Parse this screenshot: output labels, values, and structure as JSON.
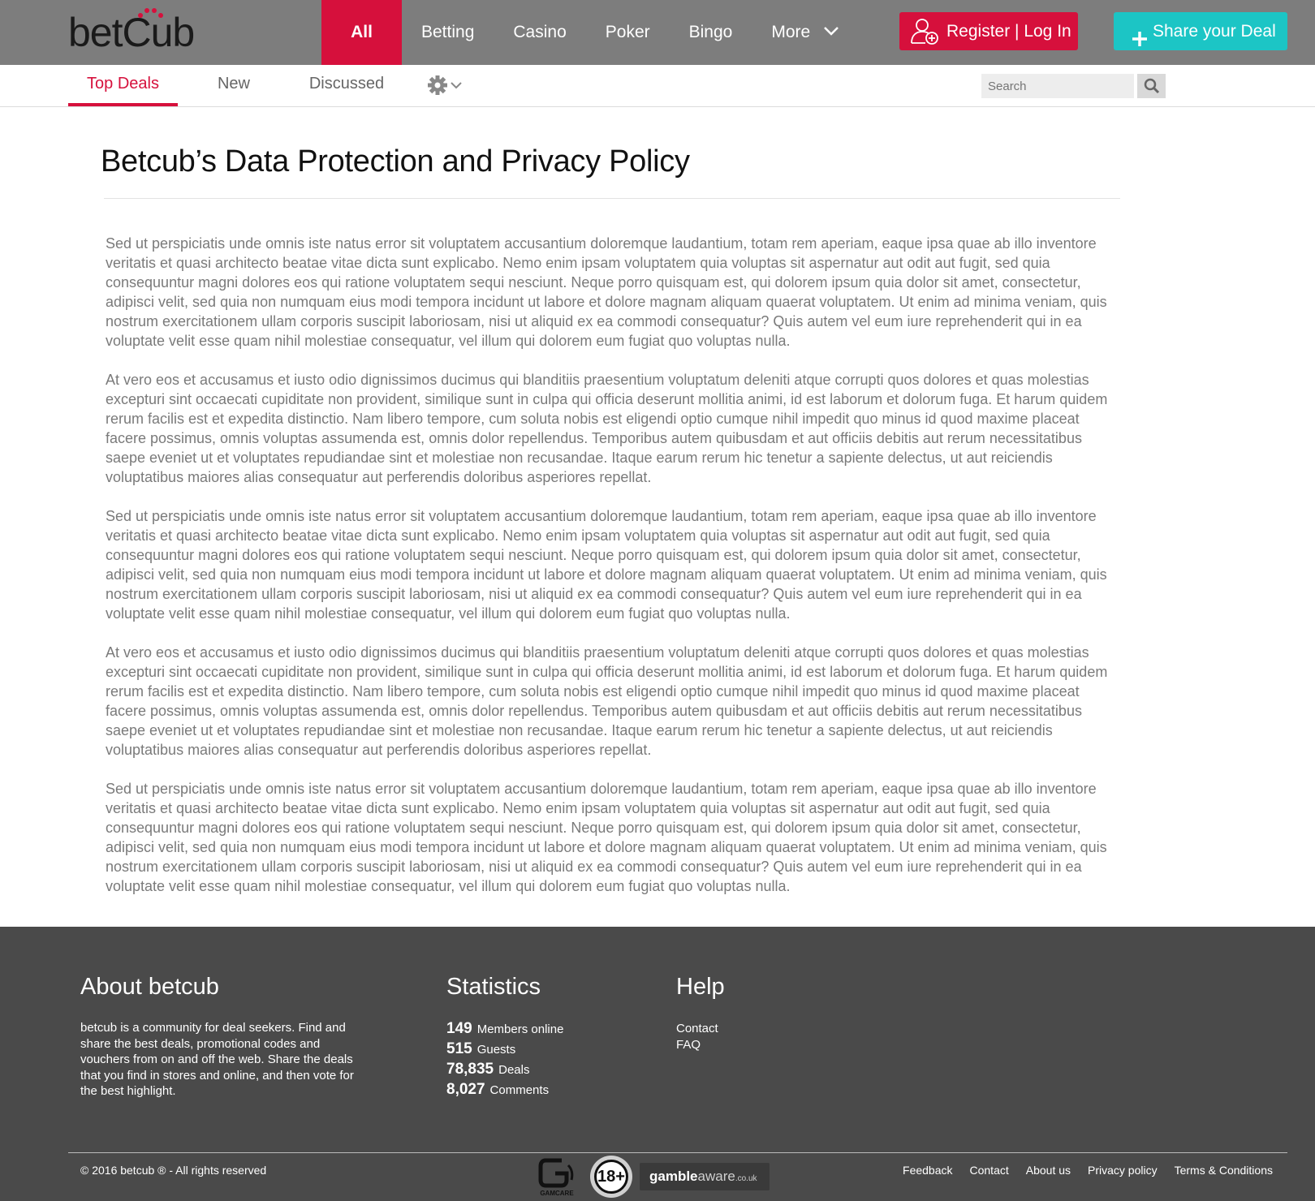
{
  "header": {
    "logo": {
      "text_bet": "bet",
      "text_cub": "Cub"
    },
    "nav": [
      {
        "label": "All",
        "active": true
      },
      {
        "label": "Betting"
      },
      {
        "label": "Casino"
      },
      {
        "label": "Poker"
      },
      {
        "label": "Bingo"
      },
      {
        "label": "More"
      }
    ],
    "register_label": "Register | Log In",
    "share_label": "Share your Deal",
    "icons": {
      "register": "user-plus-icon",
      "share": "plus-icon",
      "more": "chevron-down-icon"
    }
  },
  "subnav": {
    "tabs": [
      {
        "label": "Top Deals",
        "active": true
      },
      {
        "label": "New"
      },
      {
        "label": "Discussed"
      }
    ],
    "settings_icon": "gear-icon",
    "search_placeholder": "Search",
    "search_icon": "search-icon"
  },
  "page": {
    "title": "Betcub’s Data Protection and Privacy Policy",
    "paragraphs": [
      "Sed ut perspiciatis unde omnis iste natus error sit voluptatem accusantium doloremque laudantium, totam rem aperiam, eaque ipsa quae ab illo inventore veritatis et quasi architecto beatae vitae dicta sunt explicabo. Nemo enim ipsam voluptatem quia voluptas sit aspernatur aut odit aut fugit, sed quia consequuntur magni dolores eos qui ratione voluptatem sequi nesciunt. Neque porro quisquam est, qui dolorem ipsum quia dolor sit amet, consectetur, adipisci velit, sed quia non numquam eius modi tempora incidunt ut labore et dolore magnam aliquam quaerat voluptatem. Ut enim ad minima veniam, quis nostrum exercitationem ullam corporis suscipit laboriosam, nisi ut aliquid ex ea commodi consequatur? Quis autem vel eum iure reprehenderit qui in ea voluptate velit esse quam nihil molestiae consequatur, vel illum qui dolorem eum fugiat quo voluptas nulla.",
      "At vero eos et accusamus et iusto odio dignissimos ducimus qui blanditiis praesentium voluptatum deleniti atque corrupti quos dolores et quas molestias excepturi sint occaecati cupiditate non provident, similique sunt in culpa qui officia deserunt mollitia animi, id est laborum et dolorum fuga. Et harum quidem rerum facilis est et expedita distinctio. Nam libero tempore, cum soluta nobis est eligendi optio cumque nihil impedit quo minus id quod maxime placeat facere possimus, omnis voluptas assumenda est, omnis dolor repellendus. Temporibus autem quibusdam et aut officiis debitis aut rerum necessitatibus saepe eveniet ut et voluptates repudiandae sint et molestiae non recusandae. Itaque earum rerum hic tenetur a sapiente delectus, ut aut reiciendis voluptatibus maiores alias consequatur aut perferendis doloribus asperiores repellat.",
      "Sed ut perspiciatis unde omnis iste natus error sit voluptatem accusantium doloremque laudantium, totam rem aperiam, eaque ipsa quae ab illo inventore veritatis et quasi architecto beatae vitae dicta sunt explicabo. Nemo enim ipsam voluptatem quia voluptas sit aspernatur aut odit aut fugit, sed quia consequuntur magni dolores eos qui ratione voluptatem sequi nesciunt. Neque porro quisquam est, qui dolorem ipsum quia dolor sit amet, consectetur, adipisci velit, sed quia non numquam eius modi tempora incidunt ut labore et dolore magnam aliquam quaerat voluptatem. Ut enim ad minima veniam, quis nostrum exercitationem ullam corporis suscipit laboriosam, nisi ut aliquid ex ea commodi consequatur? Quis autem vel eum iure reprehenderit qui in ea voluptate velit esse quam nihil molestiae consequatur, vel illum qui dolorem eum fugiat quo voluptas nulla.",
      "At vero eos et accusamus et iusto odio dignissimos ducimus qui blanditiis praesentium voluptatum deleniti atque corrupti quos dolores et quas molestias excepturi sint occaecati cupiditate non provident, similique sunt in culpa qui officia deserunt mollitia animi, id est laborum et dolorum fuga. Et harum quidem rerum facilis est et expedita distinctio. Nam libero tempore, cum soluta nobis est eligendi optio cumque nihil impedit quo minus id quod maxime placeat facere possimus, omnis voluptas assumenda est, omnis dolor repellendus. Temporibus autem quibusdam et aut officiis debitis aut rerum necessitatibus saepe eveniet ut et voluptates repudiandae sint et molestiae non recusandae. Itaque earum rerum hic tenetur a sapiente delectus, ut aut reiciendis voluptatibus maiores alias consequatur aut perferendis doloribus asperiores repellat.",
      "Sed ut perspiciatis unde omnis iste natus error sit voluptatem accusantium doloremque laudantium, totam rem aperiam, eaque ipsa quae ab illo inventore veritatis et quasi architecto beatae vitae dicta sunt explicabo. Nemo enim ipsam voluptatem quia voluptas sit aspernatur aut odit aut fugit, sed quia consequuntur magni dolores eos qui ratione voluptatem sequi nesciunt. Neque porro quisquam est, qui dolorem ipsum quia dolor sit amet, consectetur, adipisci velit, sed quia non numquam eius modi tempora incidunt ut labore et dolore magnam aliquam quaerat voluptatem. Ut enim ad minima veniam, quis nostrum exercitationem ullam corporis suscipit laboriosam, nisi ut aliquid ex ea commodi consequatur? Quis autem vel eum iure reprehenderit qui in ea voluptate velit esse quam nihil molestiae consequatur, vel illum qui dolorem eum fugiat quo voluptas nulla."
    ]
  },
  "footer": {
    "about": {
      "title": "About betcub",
      "text": "betcub is a community for deal seekers. Find and share the best deals, promotional codes and vouchers from on and off the web. Share the deals that you find in stores and online, and then vote for the best highlight."
    },
    "statistics": {
      "title": "Statistics",
      "rows": [
        {
          "num": "149",
          "label": "Members online"
        },
        {
          "num": "515",
          "label": "Guests"
        },
        {
          "num": "78,835",
          "label": "Deals"
        },
        {
          "num": "8,027",
          "label": "Comments"
        }
      ]
    },
    "help": {
      "title": "Help",
      "links": [
        "Contact",
        "FAQ"
      ]
    },
    "copyright": "© 2016 betcub ® - All rights reserved",
    "badges": {
      "gamcare": "GAMCARE",
      "age": "18+",
      "gambleaware_bold": "gamble",
      "gambleaware_light": "aware",
      "gambleaware_suffix": ".co.uk"
    },
    "links": [
      "Feedback",
      "Contact",
      "About us",
      "Privacy policy",
      "Terms & Conditions"
    ]
  },
  "colors": {
    "brand_red": "#d6103c",
    "accent_teal": "#1cc5c5",
    "header_gray": "#7d7d7d",
    "footer_dark": "#4a4a4a"
  }
}
